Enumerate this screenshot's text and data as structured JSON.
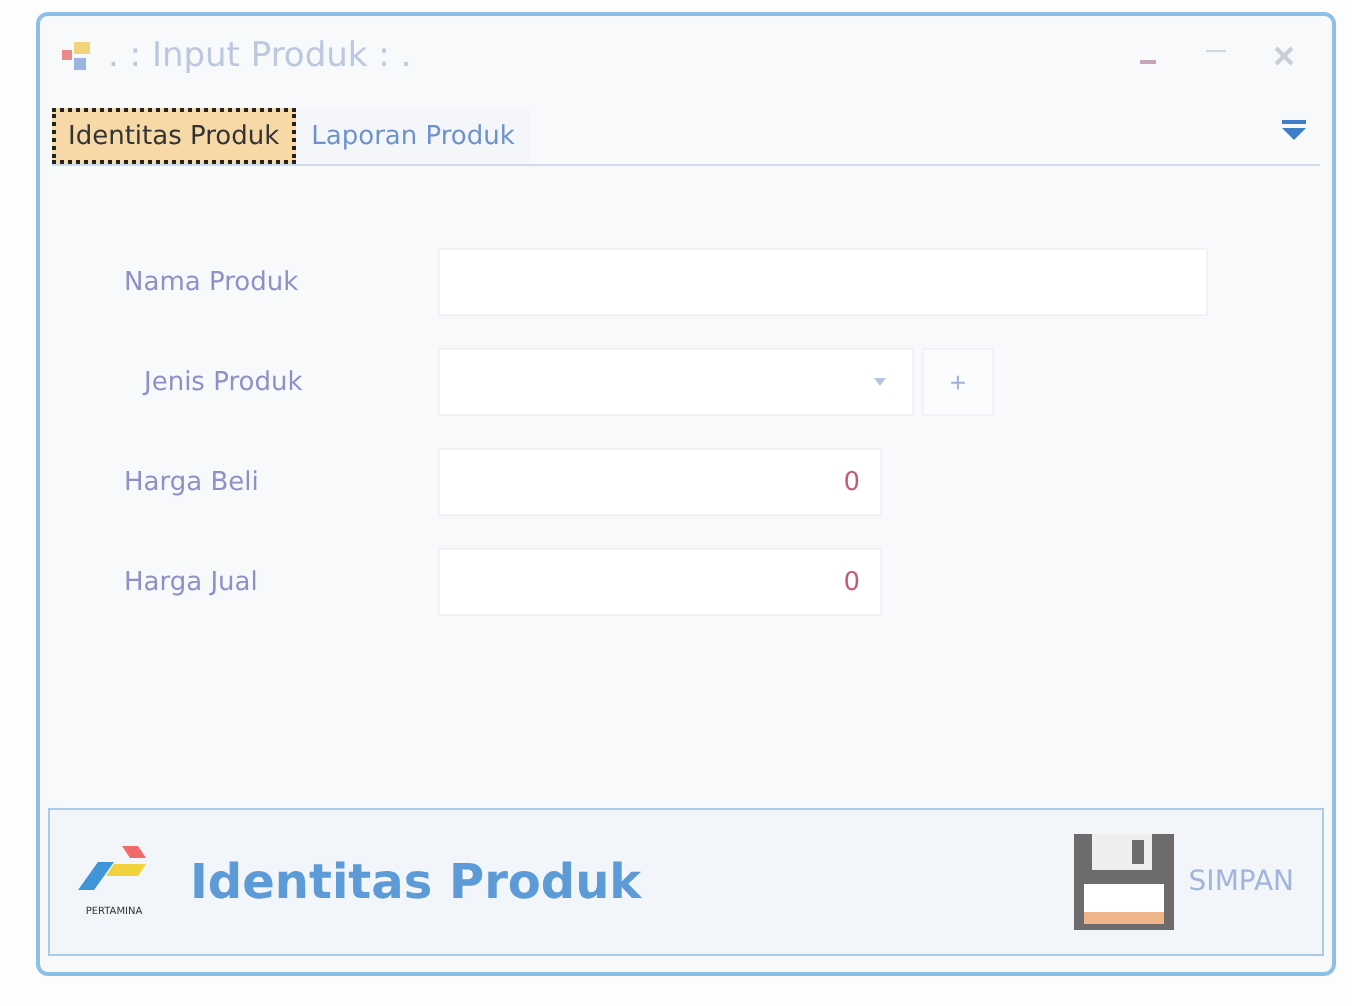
{
  "window": {
    "title": ". : Input Produk : ."
  },
  "tabs": [
    {
      "label": "Identitas Produk",
      "selected": true
    },
    {
      "label": "Laporan Produk",
      "selected": false
    }
  ],
  "form": {
    "fields": [
      {
        "kind": "text",
        "label": "Nama Produk"
      },
      {
        "kind": "combo",
        "label": "Jenis Produk",
        "add_button": "+"
      },
      {
        "kind": "number",
        "label": "Harga Beli",
        "value": "0"
      },
      {
        "kind": "number",
        "label": "Harga Jual",
        "value": "0"
      }
    ]
  },
  "footer": {
    "logo_caption": "PERTAMINA",
    "heading": "Identitas Produk",
    "save_button": "SIMPAN"
  }
}
